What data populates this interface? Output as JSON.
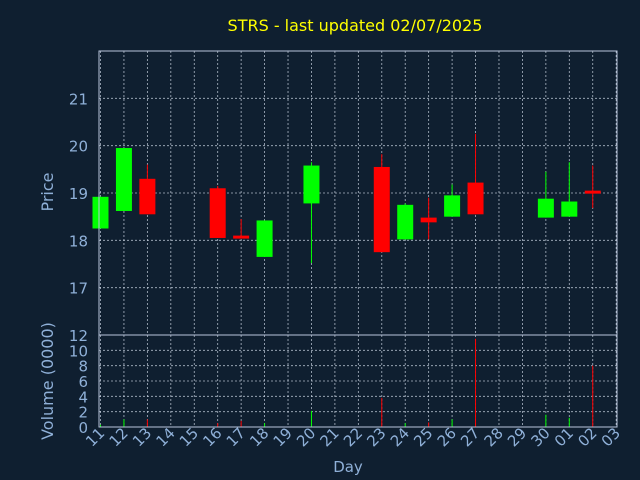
{
  "chart_data": {
    "type": "candlestick",
    "title": "STRS - last updated 02/07/2025",
    "xlabel": "Day",
    "ylabel": "Price",
    "volume_label": "Volume (0000)",
    "grid": true,
    "price_ylim": [
      16.0,
      22.0
    ],
    "price_yticks": [
      17,
      18,
      19,
      20,
      21
    ],
    "volume_ylim": [
      0,
      12
    ],
    "volume_yticks": [
      0,
      2,
      4,
      6,
      8,
      10,
      12
    ],
    "x_tick_labels": [
      "11",
      "12",
      "13",
      "14",
      "15",
      "16",
      "17",
      "18",
      "19",
      "20",
      "21",
      "22",
      "23",
      "24",
      "25",
      "26",
      "27",
      "28",
      "29",
      "30",
      "01",
      "02",
      "03"
    ],
    "candles": [
      {
        "day": "11",
        "open": 18.25,
        "high": 18.92,
        "low": 18.25,
        "close": 18.92,
        "volume": 0.3
      },
      {
        "day": "12",
        "open": 18.62,
        "high": 19.95,
        "low": 18.62,
        "close": 19.95,
        "volume": 1.0
      },
      {
        "day": "13",
        "open": 19.3,
        "high": 19.6,
        "low": 18.55,
        "close": 18.55,
        "volume": 1.0
      },
      {
        "day": "16",
        "open": 19.1,
        "high": 19.15,
        "low": 18.05,
        "close": 18.05,
        "volume": 0.5
      },
      {
        "day": "17",
        "open": 18.1,
        "high": 18.45,
        "low": 18.05,
        "close": 18.05,
        "volume": 0.8
      },
      {
        "day": "18",
        "open": 17.65,
        "high": 18.42,
        "low": 17.65,
        "close": 18.42,
        "volume": 0.5
      },
      {
        "day": "20",
        "open": 18.78,
        "high": 19.65,
        "low": 17.52,
        "close": 19.58,
        "volume": 2.1
      },
      {
        "day": "23",
        "open": 19.55,
        "high": 19.82,
        "low": 17.75,
        "close": 17.75,
        "volume": 3.8
      },
      {
        "day": "24",
        "open": 18.02,
        "high": 18.78,
        "low": 18.02,
        "close": 18.75,
        "volume": 0.5
      },
      {
        "day": "25",
        "open": 18.48,
        "high": 18.9,
        "low": 18.02,
        "close": 18.38,
        "volume": 0.6
      },
      {
        "day": "26",
        "open": 18.5,
        "high": 19.18,
        "low": 18.5,
        "close": 18.95,
        "volume": 1.0
      },
      {
        "day": "27",
        "open": 19.22,
        "high": 20.25,
        "low": 18.55,
        "close": 18.55,
        "volume": 11.5
      },
      {
        "day": "30",
        "open": 18.48,
        "high": 19.45,
        "low": 18.48,
        "close": 18.88,
        "volume": 1.6
      },
      {
        "day": "01",
        "open": 18.5,
        "high": 19.65,
        "low": 18.5,
        "close": 18.82,
        "volume": 1.2
      },
      {
        "day": "02",
        "open": 19.05,
        "high": 19.58,
        "low": 18.68,
        "close": 19.0,
        "volume": 8.0
      }
    ]
  },
  "colors": {
    "background": "#0f1f30",
    "up": "#00ff00",
    "down": "#ff0000",
    "axis": "#b9c6dc",
    "text": "#8fb0d8",
    "title": "#ffff00",
    "grid": "#c8d2e0"
  }
}
